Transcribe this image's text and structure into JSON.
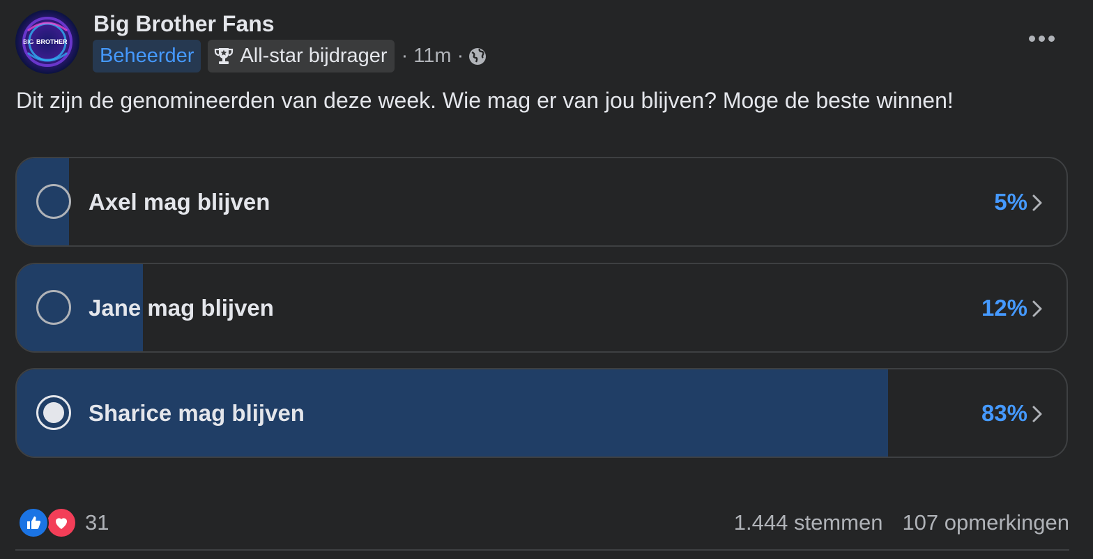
{
  "post": {
    "group_name": "Big Brother Fans",
    "avatar_text": {
      "big": "BIG",
      "brother": "BROTHER"
    },
    "badge_admin": "Beheerder",
    "badge_allstar": "All-star bijdrager",
    "time": "· 11m ·",
    "visibility_icon": "globe-icon",
    "text": "Dit zijn de genomineerden van deze week. Wie mag er van jou blijven? Moge de beste winnen!"
  },
  "poll": {
    "options": [
      {
        "label": "Axel mag blijven",
        "percent_text": "5%",
        "percent": 5,
        "selected": false
      },
      {
        "label": "Jane mag blijven",
        "percent_text": "12%",
        "percent": 12,
        "selected": false
      },
      {
        "label": "Sharice mag blijven",
        "percent_text": "83%",
        "percent": 83,
        "selected": true
      }
    ]
  },
  "footer": {
    "reaction_count": "31",
    "votes": "1.444 stemmen",
    "comments": "107 opmerkingen"
  },
  "colors": {
    "background": "#242526",
    "accent": "#4599ff",
    "poll_fill": "#203e66",
    "like": "#1b74e4",
    "love": "#f33e58"
  }
}
